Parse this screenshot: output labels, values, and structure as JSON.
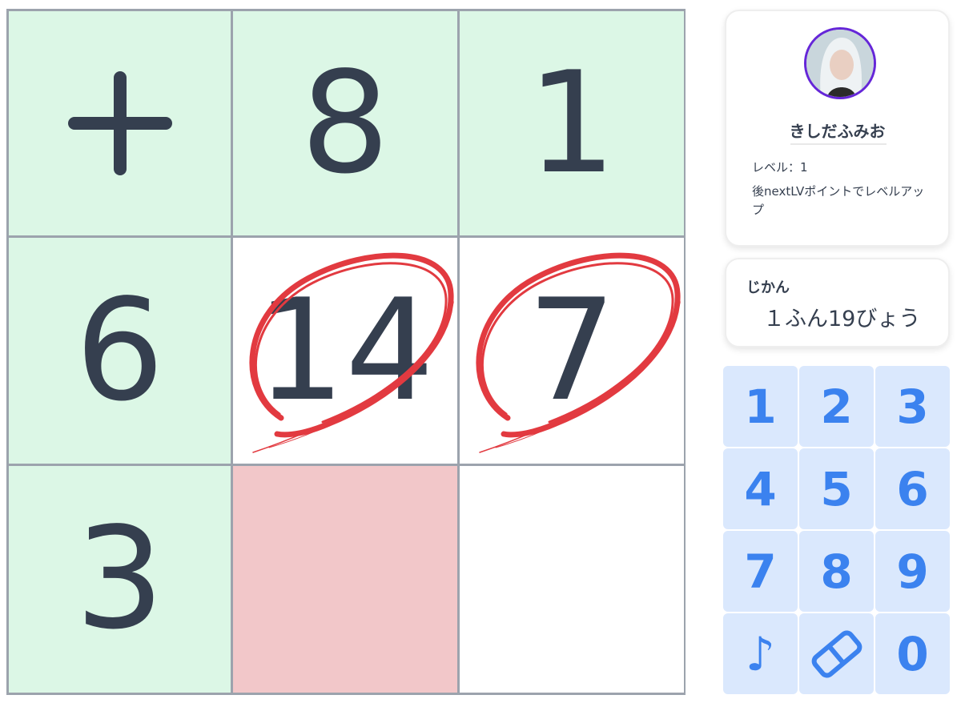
{
  "board": {
    "operator": "+",
    "operator_icon": "plus-icon",
    "column_headers": [
      "8",
      "1"
    ],
    "row_headers": [
      "6",
      "3"
    ],
    "answers": [
      "14",
      "7",
      "",
      ""
    ],
    "correct_mark_color": "#e23a40",
    "active_cell_color": "#f2c7c9",
    "header_cell_color": "#dcf7e6"
  },
  "profile": {
    "name": "きしだふみお",
    "level": "レベル：1",
    "next_level_text": "後nextLVポイントでレベルアップ"
  },
  "timer": {
    "label": "じかん",
    "value": "１ふん19びょう"
  },
  "keypad": {
    "keys": [
      "1",
      "2",
      "3",
      "4",
      "5",
      "6",
      "7",
      "8",
      "9",
      "♪",
      "eraser-icon",
      "0"
    ],
    "accent_color": "#3b82ef",
    "background_color": "#dae8fd"
  }
}
